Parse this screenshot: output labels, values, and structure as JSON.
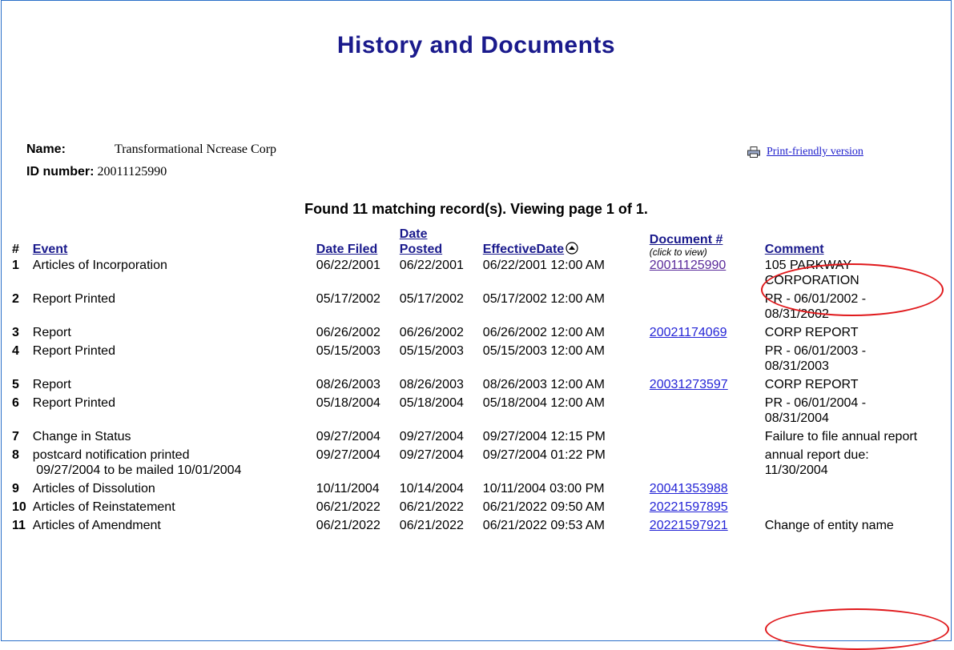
{
  "header": {
    "title": "History and Documents"
  },
  "entity": {
    "name_label": "Name:",
    "name_value": "Transformational Ncrease Corp",
    "id_label": "ID number:",
    "id_value": "20011125990"
  },
  "print_link": {
    "label": "Print-friendly version",
    "icon": "printer-icon"
  },
  "summary": "Found 11 matching record(s).  Viewing page 1 of 1.",
  "columns": {
    "num": "#",
    "event": "Event",
    "date_filed": "Date Filed",
    "date_posted": "Date Posted",
    "effective_date": "EffectiveDate",
    "document": "Document #",
    "document_sub": "(click to view)",
    "comment": "Comment"
  },
  "rows": [
    {
      "num": "1",
      "event": "Articles of Incorporation",
      "filed": "06/22/2001",
      "posted": "06/22/2001",
      "effective": "06/22/2001 12:00 AM",
      "doc": "20011125990",
      "comment": "105 PARKWAY CORPORATION"
    },
    {
      "num": "2",
      "event": "Report Printed",
      "filed": "05/17/2002",
      "posted": "05/17/2002",
      "effective": "05/17/2002 12:00 AM",
      "doc": "",
      "comment": "PR - 06/01/2002 - 08/31/2002"
    },
    {
      "num": "3",
      "event": "Report",
      "filed": "06/26/2002",
      "posted": "06/26/2002",
      "effective": "06/26/2002 12:00 AM",
      "doc": "20021174069",
      "comment": "CORP REPORT"
    },
    {
      "num": "4",
      "event": "Report Printed",
      "filed": "05/15/2003",
      "posted": "05/15/2003",
      "effective": "05/15/2003 12:00 AM",
      "doc": "",
      "comment": "PR - 06/01/2003 - 08/31/2003"
    },
    {
      "num": "5",
      "event": "Report",
      "filed": "08/26/2003",
      "posted": "08/26/2003",
      "effective": "08/26/2003 12:00 AM",
      "doc": "20031273597",
      "comment": "CORP REPORT"
    },
    {
      "num": "6",
      "event": "Report Printed",
      "filed": "05/18/2004",
      "posted": "05/18/2004",
      "effective": "05/18/2004 12:00 AM",
      "doc": "",
      "comment": "PR - 06/01/2004 - 08/31/2004"
    },
    {
      "num": "7",
      "event": "Change in Status",
      "filed": "09/27/2004",
      "posted": "09/27/2004",
      "effective": "09/27/2004 12:15 PM",
      "doc": "",
      "comment": "Failure to file annual report"
    },
    {
      "num": "8",
      "event": "postcard notification printed",
      "event2": " 09/27/2004 to be mailed 10/01/2004",
      "filed": "09/27/2004",
      "posted": "09/27/2004",
      "effective": "09/27/2004 01:22 PM",
      "doc": "",
      "comment": "annual report due: 11/30/2004"
    },
    {
      "num": "9",
      "event": "Articles of Dissolution",
      "filed": "10/11/2004",
      "posted": "10/14/2004",
      "effective": "10/11/2004 03:00 PM",
      "doc": "20041353988",
      "comment": ""
    },
    {
      "num": "10",
      "event": "Articles of Reinstatement",
      "filed": "06/21/2022",
      "posted": "06/21/2022",
      "effective": "06/21/2022 09:50 AM",
      "doc": "20221597895",
      "comment": ""
    },
    {
      "num": "11",
      "event": "Articles of Amendment",
      "filed": "06/21/2022",
      "posted": "06/21/2022",
      "effective": "06/21/2022 09:53 AM",
      "doc": "20221597921",
      "comment": "Change of entity name"
    }
  ],
  "colors": {
    "title": "#1a1a8c",
    "link": "#2424d6",
    "visited_link": "#5a2a9a",
    "annotation": "#e0191c",
    "frame": "#2a6fc9"
  }
}
